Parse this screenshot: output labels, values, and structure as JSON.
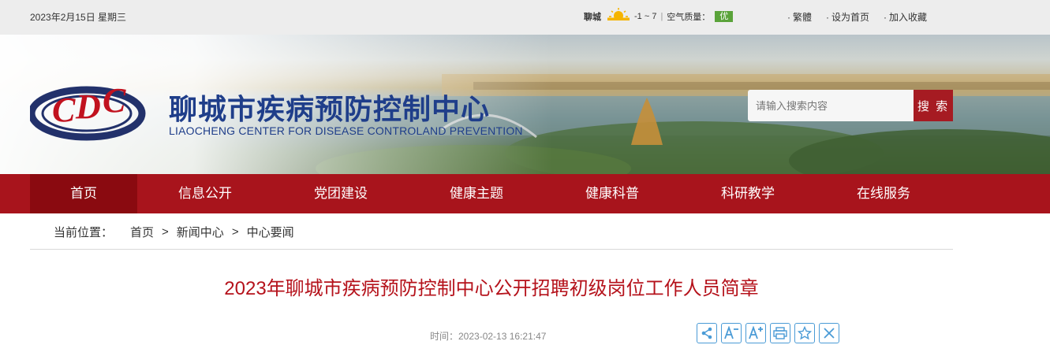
{
  "topbar": {
    "date": "2023年2月15日 星期三",
    "weather": {
      "city": "聊城",
      "temp": "-1 ~ 7",
      "aqi_label": "空气质量：",
      "aqi_value": "优",
      "icon": "sunny-icon"
    },
    "links": [
      "繁體",
      "设为首页",
      "加入收藏"
    ]
  },
  "banner": {
    "title": "聊城市疾病预防控制中心",
    "subtitle": "LIAOCHENG CENTER FOR DISEASE CONTROLAND PREVENTION",
    "logo_text": "CDC"
  },
  "search": {
    "placeholder": "请输入搜索内容",
    "button": "搜 索"
  },
  "nav": {
    "items": [
      "首页",
      "信息公开",
      "党团建设",
      "健康主题",
      "健康科普",
      "科研教学",
      "在线服务"
    ],
    "active": "首页"
  },
  "breadcrumb": {
    "label": "当前位置：",
    "items": [
      "首页",
      "新闻中心",
      "中心要闻"
    ],
    "separator": ">"
  },
  "article": {
    "title": "2023年聊城市疾病预防控制中心公开招聘初级岗位工作人员简章",
    "time": "时间：2023-02-13 16:21:47"
  },
  "tools": [
    "share-icon",
    "font-decrease-icon",
    "font-increase-icon",
    "print-icon",
    "favorite-icon",
    "close-icon"
  ],
  "colors": {
    "brand_red": "#a8141c",
    "title_blue": "#1f3e8a",
    "tool_blue": "#4a9bd6"
  }
}
